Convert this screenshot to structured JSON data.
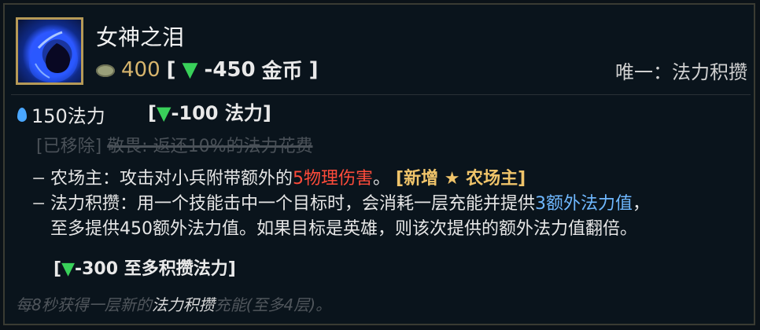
{
  "item": {
    "name": "女神之泪",
    "cost": {
      "gold": "400",
      "bracket_open": "[",
      "down_arrow": "▼",
      "change": "-450",
      "unit": "金币",
      "bracket_close": "]"
    },
    "unique": "唯一：法力积攒"
  },
  "stats": {
    "mana": "150法力",
    "change_open": "[",
    "change_arrow": "▼",
    "change_value": "-100",
    "change_unit": "法力",
    "change_close": "]"
  },
  "removed": {
    "tag": "[已移除]",
    "text": "敬畏: 返还10%的法力花费"
  },
  "passives": [
    {
      "dash": "−",
      "label": "农场主：",
      "text_a": "攻击对小兵附带额外的",
      "highlight": "5物理伤害",
      "text_b": "。",
      "tag": "[新增 ★ 农场主]"
    },
    {
      "dash": "−",
      "label": "法力积攒：",
      "text_a": "用一个技能击中一个目标时，会消耗一层充能并提供",
      "highlight": "3额外法力值",
      "text_b": "，",
      "continuation": "至多提供450额外法力值。如果目标是英雄，则该次提供的额外法力值翻倍。"
    }
  ],
  "change_tag_2": {
    "open": "[",
    "arrow": "▼",
    "value": "-300",
    "text": "至多积攒法力",
    "close": "]"
  },
  "footer": {
    "a": "每8秒获得一层新的",
    "em": "法力积攒",
    "b": "充能(至多4层)。"
  },
  "colors": {
    "gold": "#d7b56d",
    "green": "#39d15a",
    "red": "#ff4b3a",
    "blue": "#6fb8ff",
    "frame": "#b69a57"
  },
  "icons": {
    "item_icon": "teardrop-icon",
    "gold_icon": "coin-icon",
    "mana_icon": "mana-drop-icon"
  }
}
